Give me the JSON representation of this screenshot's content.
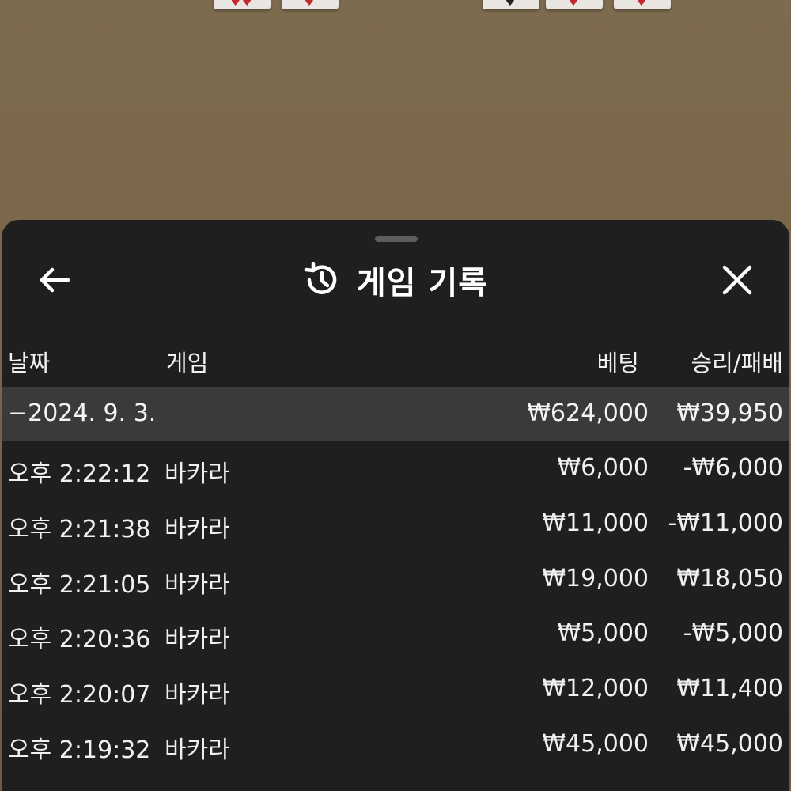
{
  "sheet": {
    "title": "게임 기록",
    "icons": {
      "back": "arrow-left-icon",
      "history": "history-clock-icon",
      "close": "close-icon"
    }
  },
  "table": {
    "headers": {
      "date": "날짜",
      "game": "게임",
      "bet": "베팅",
      "result": "승리/패배"
    },
    "summary": {
      "date": "−2024. 9. 3.",
      "bet": "₩624,000",
      "result": "₩39,950"
    },
    "rows": [
      {
        "time": "오후 2:22:12",
        "game": "바카라",
        "bet": "₩6,000",
        "result": "-₩6,000"
      },
      {
        "time": "오후 2:21:38",
        "game": "바카라",
        "bet": "₩11,000",
        "result": "-₩11,000"
      },
      {
        "time": "오후 2:21:05",
        "game": "바카라",
        "bet": "₩19,000",
        "result": "₩18,050"
      },
      {
        "time": "오후 2:20:36",
        "game": "바카라",
        "bet": "₩5,000",
        "result": "-₩5,000"
      },
      {
        "time": "오후 2:20:07",
        "game": "바카라",
        "bet": "₩12,000",
        "result": "₩11,400"
      },
      {
        "time": "오후 2:19:32",
        "game": "바카라",
        "bet": "₩45,000",
        "result": "₩45,000"
      }
    ]
  },
  "colors": {
    "sheet_background": "#1f1f1f",
    "summary_background": "#3a3a3a",
    "table_background": "#7a6649",
    "text": "#f0f0f0"
  }
}
